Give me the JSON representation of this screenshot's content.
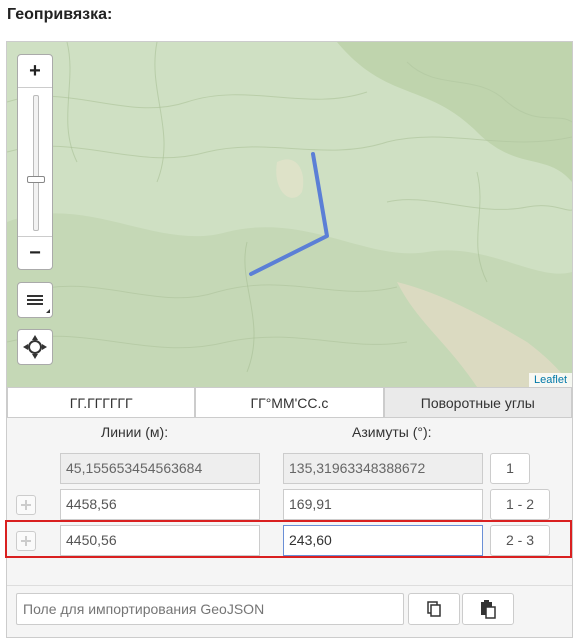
{
  "title": "Геопривязка:",
  "map": {
    "zoom_in": "+",
    "zoom_out": "−",
    "zoom_level": 0.38,
    "attribution": "Leaflet",
    "line_color": "#5b7fd6"
  },
  "tabs": [
    {
      "label": "ГГ.ГГГГГГ",
      "active": false
    },
    {
      "label": "ГГ°ММ'СС.с",
      "active": false
    },
    {
      "label": "Поворотные углы",
      "active": true
    }
  ],
  "headers": {
    "lines": "Линии (м):",
    "azimuths": "Азимуты (°):"
  },
  "rows": [
    {
      "line": "45,155653454563684",
      "azimuth": "135,31963348388672",
      "label": "1",
      "readonly": true
    },
    {
      "line": "4458,56",
      "azimuth": "169,91",
      "label": "1 - 2",
      "readonly": false
    },
    {
      "line": "4450,56",
      "azimuth": "243,60",
      "label": "2 - 3",
      "readonly": false,
      "highlighted": true
    }
  ],
  "geojson": {
    "placeholder": "Поле для импортирования GeoJSON"
  },
  "colors": {
    "highlight": "#d92020",
    "accent": "#6a8fd6"
  }
}
